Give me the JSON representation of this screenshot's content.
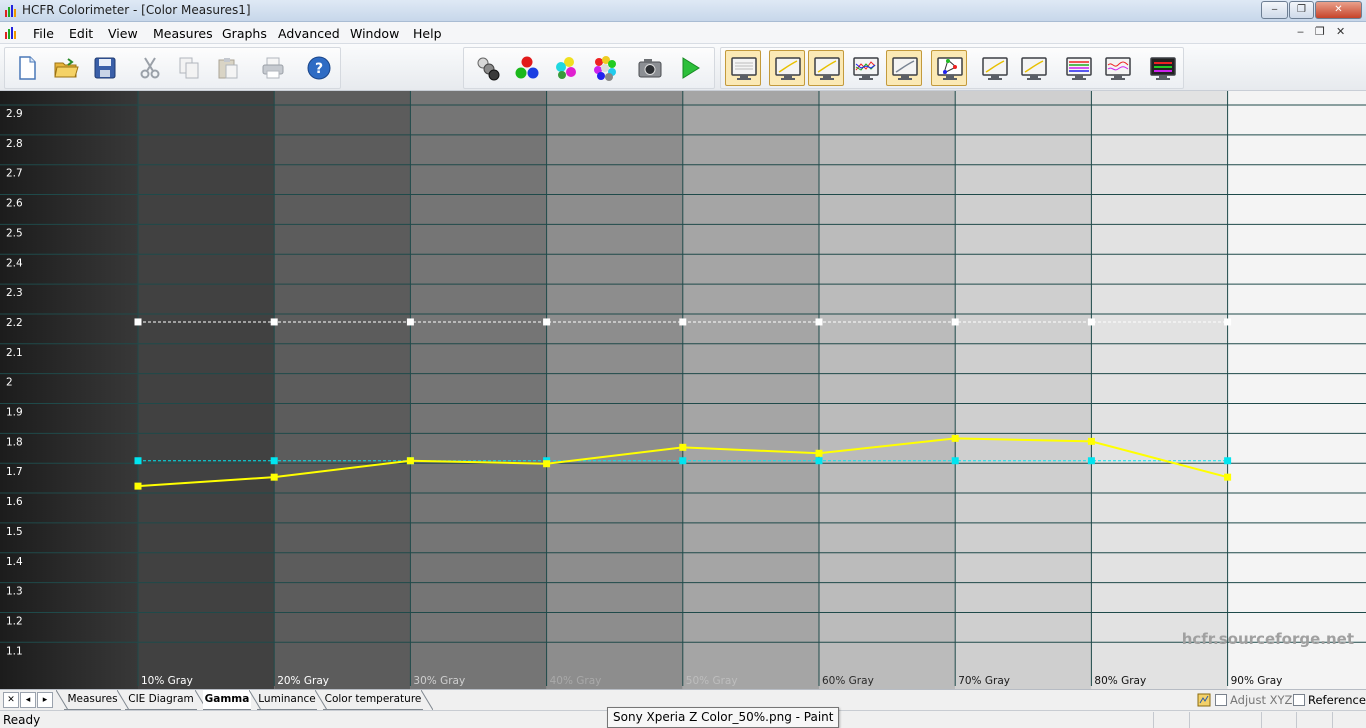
{
  "window": {
    "title": "HCFR Colorimeter - [Color Measures1]",
    "minimize": "‒",
    "maximize": "❐",
    "close": "✕"
  },
  "menu": {
    "items": [
      "File",
      "Edit",
      "View",
      "Measures",
      "Graphs",
      "Advanced",
      "Window",
      "Help"
    ],
    "mdi_minimize": "‒",
    "mdi_restore": "❐",
    "mdi_close": "✕"
  },
  "toolbar": {
    "file_group": [
      "new-document-icon",
      "open-folder-icon",
      "save-disk-icon"
    ],
    "edit_group": [
      "cut-scissors-icon",
      "copy-icon",
      "paste-icon"
    ],
    "print_group": [
      "print-icon"
    ],
    "help_group": [
      "help-icon"
    ],
    "measure_group": [
      "gray-scale-measure-icon",
      "primary-colors-measure-icon",
      "secondary-colors-measure-icon",
      "all-colors-measure-icon",
      "camera-icon",
      "play-icon"
    ],
    "graph_group": [
      "gray-scale-view-icon",
      "gamma-graph-icon",
      "luminance-graph-icon",
      "rgb-levels-graph-icon",
      "color-temperature-graph-icon",
      "cie-diagram-icon",
      "near-black-graph-icon",
      "near-white-graph-icon",
      "saturation-luminance-graph-icon",
      "saturation-shift-graph-icon",
      "measures-chart-icon"
    ],
    "pressed_graph_buttons": [
      0,
      1,
      2,
      4,
      5
    ],
    "accent": "#fbe9b5"
  },
  "chart_data": {
    "type": "line",
    "title": "",
    "xlabel": "",
    "ylabel": "",
    "categories": [
      "10% Gray",
      "20% Gray",
      "30% Gray",
      "40% Gray",
      "50% Gray",
      "60% Gray",
      "70% Gray",
      "80% Gray",
      "90% Gray"
    ],
    "ylim": [
      1.0,
      2.95
    ],
    "yticks": [
      "2.9",
      "2.8",
      "2.7",
      "2.6",
      "2.5",
      "2.4",
      "2.3",
      "2.2",
      "2.1",
      "2",
      "1.9",
      "1.8",
      "1.7",
      "1.6",
      "1.5",
      "1.4",
      "1.3",
      "1.2",
      "1.1"
    ],
    "grid": true,
    "series": [
      {
        "values": [
          2.2,
          2.2,
          2.2,
          2.2,
          2.2,
          2.2,
          2.2,
          2.2,
          2.2
        ],
        "color": "#ffffff",
        "style": "dashed"
      },
      {
        "values": [
          1.735,
          1.735,
          1.735,
          1.735,
          1.735,
          1.735,
          1.735,
          1.735,
          1.735
        ],
        "color": "#00e5f0",
        "style": "dashed"
      },
      {
        "values": [
          1.65,
          1.68,
          1.735,
          1.725,
          1.78,
          1.76,
          1.81,
          1.8,
          1.68
        ],
        "color": "#ffff00",
        "style": "solid"
      }
    ],
    "watermark": "hcfr.sourceforge.net"
  },
  "tabs": {
    "items": [
      "Measures",
      "CIE Diagram",
      "Gamma",
      "Luminance",
      "Color temperature"
    ],
    "active": "Gamma",
    "nav": [
      "✕",
      "◂",
      "▸"
    ],
    "adjust_xyz_label": "Adjust XYZ",
    "reference_label": "Reference"
  },
  "status": {
    "text": "Ready",
    "tooltip": "Sony Xperia Z Color_50%.png - Paint"
  }
}
